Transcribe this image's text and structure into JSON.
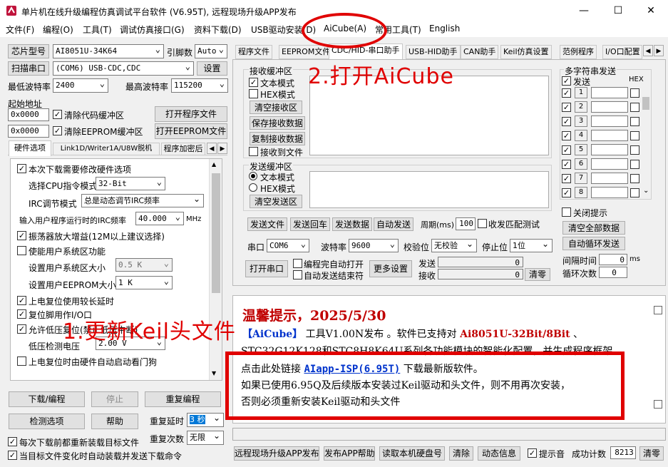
{
  "window": {
    "title": "单片机在线升级编程仿真调试平台软件 (V6.95T), 远程现场升级APP发布"
  },
  "menu": [
    "文件(F)",
    "编程(O)",
    "工具(T)",
    "调试仿真接口(G)",
    "资料下载(D)",
    "USB驱动安装(D)",
    "AiCube(A)",
    "常用工具(T)",
    "English"
  ],
  "left": {
    "chip_label": "芯片型号",
    "chip_value": "AI8051U-34K64",
    "pins_label": "引脚数",
    "pins_value": "Auto",
    "scan_button": "扫描串口",
    "port_value": "(COM6) USB-CDC,CDC",
    "settings_button": "设置",
    "min_baud_label": "最低波特率",
    "min_baud_value": "2400",
    "max_baud_label": "最高波特率",
    "max_baud_value": "115200",
    "start_addr_label": "起始地址",
    "addr1": "0x0000",
    "clear_code": "清除代码缓冲区",
    "open_prog": "打开程序文件",
    "addr2": "0x0000",
    "clear_eeprom": "清除EEPROM缓冲区",
    "open_eeprom": "打开EEPROM文件",
    "subtabs": [
      "硬件选项",
      "Link1D/Writer1A/U8W脱机",
      "程序加密后"
    ],
    "options": {
      "modify_hw": "本次下载需要修改硬件选项",
      "cpu_mode_label": "选择CPU指令模式",
      "cpu_mode_value": "32-Bit",
      "irc_mode_label": "IRC调节模式",
      "irc_mode_value": "总是动态调节IRC频率",
      "irc_freq_label": "输入用户程序运行时的IRC频率",
      "irc_freq_value": "40.000",
      "irc_unit": "MHz",
      "osc_gain": "振荡器放大增益(12M以上建议选择)",
      "user_area": "使能用户系统区功能",
      "user_area_size_label": "设置用户系统区大小",
      "user_area_size_value": "0.5 K",
      "eeprom_size_label": "设置用户EEPROM大小",
      "eeprom_size_value": "1   K",
      "long_reset": "上电复位使用较长延时",
      "reset_pin": "复位脚用作I/O口",
      "lvd_reset": "允许低压复位(禁止低压中断)",
      "lvd_label": "低压检测电压",
      "lvd_value": "2.00 V",
      "watchdog": "上电复位时由硬件自动启动看门狗"
    },
    "download_button": "下载/编程",
    "stop_button": "停止",
    "reprogram_button": "重复编程",
    "detect_button": "检测选项",
    "help_button": "帮助",
    "repeat_delay_label": "重复延时",
    "repeat_delay_value": "3 秒",
    "repeat_count_label": "重复次数",
    "repeat_count_value": "无限",
    "reload_each": "每次下载前都重新装载目标文件",
    "auto_reload": "当目标文件变化时自动装载并发送下载命令"
  },
  "right": {
    "tabs": [
      "程序文件",
      "EEPROM文件",
      "CDC/HID-串口助手",
      "USB-HID助手",
      "CAN助手",
      "Keil仿真设置",
      "范例程序",
      "I/O口配置"
    ],
    "recv_group": "接收缓冲区",
    "text_mode": "文本模式",
    "hex_mode": "HEX模式",
    "clear_recv": "清空接收区",
    "save_recv": "保存接收数据",
    "copy_recv": "复制接收数据",
    "recv_to_file": "接收到文件",
    "send_group": "发送缓冲区",
    "send_text_mode": "文本模式",
    "send_hex_mode": "HEX模式",
    "clear_send": "清空发送区",
    "send_file": "发送文件",
    "send_enter": "发送回车",
    "send_data": "发送数据",
    "auto_send": "自动发送",
    "period_label": "周期(ms)",
    "period_value": "100",
    "match_label": "收发匹配测试",
    "multi_group": "多字符串发送",
    "send_col": "发送",
    "hex_col": "HEX",
    "rows": [
      "1",
      "2",
      "3",
      "4",
      "5",
      "6",
      "7",
      "8"
    ],
    "close_tips": "关闭提示",
    "clear_all": "清空全部数据",
    "auto_loop": "自动循环发送",
    "interval_label": "间隔时间",
    "interval_value": "0",
    "interval_unit": "ms",
    "loop_label": "循环次数",
    "loop_value": "0",
    "port_label": "串口",
    "port_value": "COM6",
    "baud_label": "波特率",
    "baud_value": "9600",
    "parity_label": "校验位",
    "parity_value": "无校验",
    "stop_label": "停止位",
    "stop_value": "1位",
    "open_port": "打开串口",
    "auto_open": "编程完自动打开",
    "auto_end": "自动发送结束符",
    "more_settings": "更多设置",
    "sent_label": "发送",
    "sent_value": "0",
    "recv_label": "接收",
    "recv_value": "0",
    "clear_counter": "清零"
  },
  "notice": {
    "title": "温馨提示，2025/5/30",
    "line1_a": "【AiCube】",
    "line1_b": "工具V1.00N发布 。软件已支持对",
    "line1_c": "Ai8051U-32Bit/8Bit",
    "line1_d": "、",
    "line2": "STC32G12K128和STC8H8K64U系列各功能模块的智能化配置，并生成程序框架。",
    "line3_a": "点击此处链接",
    "line3_link": "AIapp-ISP(6.95T)",
    "line3_b": "下载最新版软件。",
    "line4": "如果已使用6.95Q及后续版本安装过Keil驱动和头文件，则不用再次安装，",
    "line5": "否则必须重新安装Keil驱动和头文件"
  },
  "bottom": {
    "remote_upgrade": "远程现场升级APP发布",
    "publish_help": "发布APP帮助",
    "read_disk": "读取本机硬盘号",
    "clear": "清除",
    "dynamic_info": "动态信息",
    "beep": "提示音",
    "success_label": "成功计数",
    "success_value": "8213",
    "clear_count": "清零"
  },
  "annotations": {
    "step1": "1.更新Keil头文件",
    "step2": "2.打开AiCube"
  }
}
